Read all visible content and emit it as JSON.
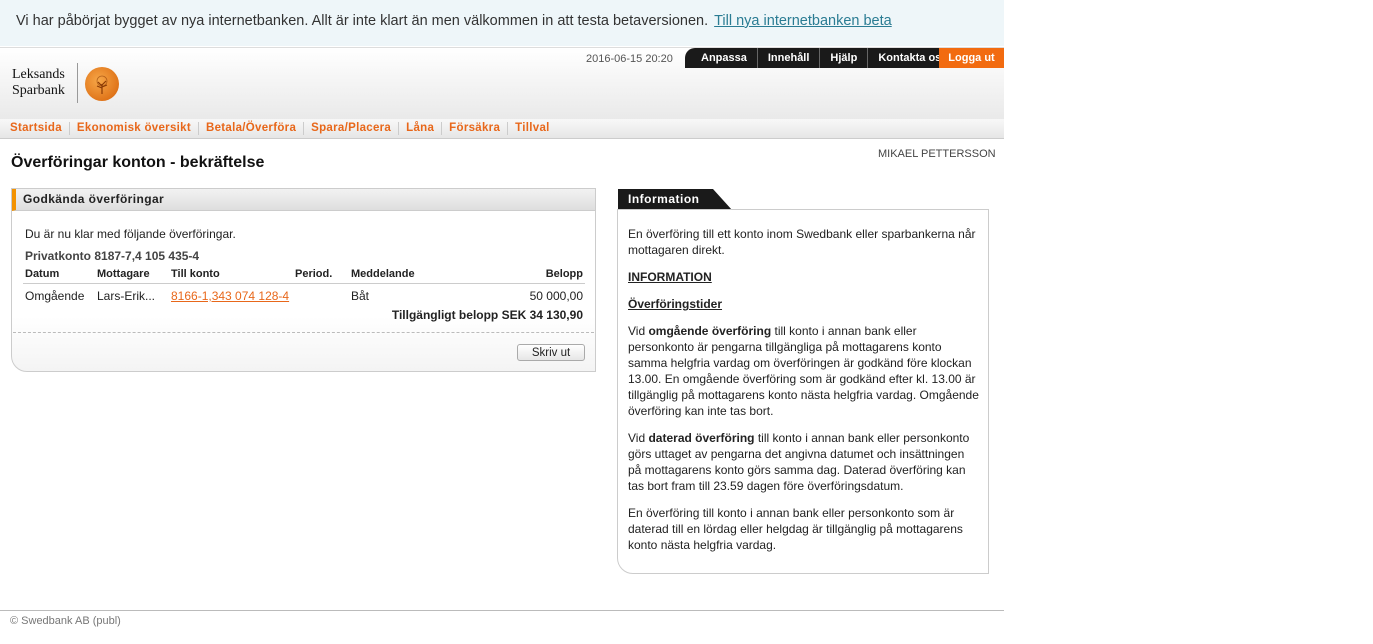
{
  "banner": {
    "text": "Vi har påbörjat bygget av nya internetbanken. Allt är inte klart än men välkommen in att testa betaversionen.",
    "link": "Till nya internetbanken beta"
  },
  "logo": {
    "line1": "Leksands",
    "line2": "Sparbank"
  },
  "header": {
    "datetime": "2016-06-15 20:20",
    "links": [
      "Anpassa",
      "Innehåll",
      "Hjälp",
      "Kontakta oss"
    ],
    "logout": "Logga ut"
  },
  "nav": [
    "Startsida",
    "Ekonomisk översikt",
    "Betala/Överföra",
    "Spara/Placera",
    "Låna",
    "Försäkra",
    "Tillval"
  ],
  "page": {
    "title": "Överföringar konton - bekräftelse",
    "user": "MIKAEL PETTERSSON"
  },
  "transfers": {
    "heading": "Godkända överföringar",
    "intro": "Du är nu klar med följande överföringar.",
    "account": "Privatkonto 8187-7,4 105 435-4",
    "columns": {
      "date": "Datum",
      "recipient": "Mottagare",
      "to_account": "Till konto",
      "period": "Period.",
      "message": "Meddelande",
      "amount": "Belopp"
    },
    "rows": [
      {
        "date": "Omgående",
        "recipient": "Lars-Erik...",
        "to_account": "8166-1,343 074 128-4",
        "period": "",
        "message": "Båt",
        "amount": "50 000,00"
      }
    ],
    "available": "Tillgängligt belopp SEK 34 130,90",
    "print_button": "Skriv ut"
  },
  "info": {
    "tab": "Information",
    "p1": "En överföring till ett konto inom Swedbank eller sparbankerna når mottagaren direkt.",
    "heading1": "INFORMATION",
    "heading2": "Överföringstider",
    "p2_pre": "Vid ",
    "p2_bold": "omgående överföring",
    "p2_post": " till konto i annan bank eller personkonto är pengarna tillgängliga på mottagarens konto samma helgfria vardag om överföringen är godkänd före klockan 13.00. En omgående överföring som är godkänd efter kl. 13.00 är tillgänglig på mottagarens konto nästa helgfria vardag. Omgående överföring kan inte tas bort.",
    "p3_pre": "Vid ",
    "p3_bold": "daterad överföring",
    "p3_post": " till konto i annan bank eller personkonto görs uttaget av pengarna det angivna datumet och insättningen på mottagarens konto görs samma dag. Daterad överföring kan tas bort fram till 23.59 dagen före överföringsdatum.",
    "p4": "En överföring till konto i annan bank eller personkonto som är daterad till en lördag eller helgdag är tillgänglig på mottagarens konto nästa helgfria vardag."
  },
  "footer": "© Swedbank AB (publ)",
  "colors": {
    "accent": "#f26b10",
    "nav_text": "#e8671a",
    "link": "#2a7c93"
  }
}
